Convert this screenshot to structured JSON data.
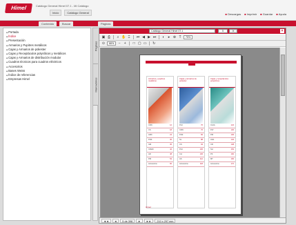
{
  "app": {
    "logo": "Himel",
    "title": "Catálogo General Himel 07.1  -  Mi Catálogo"
  },
  "topnav": [
    "Inicio",
    "Catálogo General"
  ],
  "toplinks": [
    "Descargas",
    "Imprimir",
    "Guardar",
    "Ayuda"
  ],
  "tabs": [
    "Contenido",
    "Buscar",
    "Páginas"
  ],
  "sidebar": {
    "items": [
      "Portada",
      "Índice",
      "Presentación",
      "Armarios y Pupitres metálicos",
      "Cajas y Armarios de poliester",
      "Cajas y Receptáculos polysíticos y metálicos",
      "Cajas y Armarios de distribución modular",
      "Cuadros técnicos para cuadros eléctricos",
      "Accesorios",
      "Bases Weiss",
      "Índice de referencias",
      "Empresas Himel"
    ],
    "active_index": 1
  },
  "vtabs": [
    "Páginas",
    "Marcadores"
  ],
  "viewer": {
    "doc_title": "Catálogo General Himel 07.1",
    "page_number": "5",
    "go_label": "Ir",
    "close": "×",
    "zoom": "66%",
    "zoom2": "75%",
    "toolbar_icons": [
      "save-icon",
      "print-icon",
      "find-icon",
      "hand-icon",
      "select-icon",
      "first-page-icon",
      "prev-page-icon",
      "next-page-icon",
      "last-page-icon",
      "back-icon",
      "forward-icon",
      "zoom-in-icon",
      "text-icon"
    ],
    "status": [
      "◄◄",
      "◄",
      "5 de 398",
      "►",
      "►►",
      "210 x 297 mm"
    ]
  },
  "page": {
    "columns": [
      {
        "heading": "Armarios y pupitres metálicos",
        "image_color": "#d9542f",
        "rows": [
          [
            "CRN",
            "12"
          ],
          [
            "CS",
            "18"
          ],
          [
            "AMC",
            "24"
          ],
          [
            "PLM",
            "30"
          ],
          [
            "GM",
            "36"
          ],
          [
            "CRHN",
            "42"
          ],
          [
            "AR",
            "48"
          ],
          [
            "PM",
            "54"
          ],
          [
            "Accesorios",
            "60"
          ]
        ]
      },
      {
        "heading": "Cajas y armarios de poliester",
        "image_color": "#3f77b8",
        "rows": [
          [
            "PLC",
            "70"
          ],
          [
            "CRN",
            "76"
          ],
          [
            "PLM",
            "82"
          ],
          [
            "SL",
            "88"
          ],
          [
            "CS",
            "94"
          ],
          [
            "PLC",
            "100"
          ],
          [
            "CH",
            "106"
          ],
          [
            "AS",
            "112"
          ],
          [
            "Accesorios",
            "118"
          ]
        ]
      },
      {
        "heading": "Cajas y receptáculos polysíticos",
        "image_color": "#3fa8a2",
        "rows": [
          [
            "CAJA",
            "124"
          ],
          [
            "PLT",
            "130"
          ],
          [
            "PM",
            "136"
          ],
          [
            "ASA",
            "142"
          ],
          [
            "CR",
            "148"
          ],
          [
            "SH",
            "154"
          ],
          [
            "PK",
            "160"
          ],
          [
            "MT",
            "166"
          ],
          [
            "Accesorios",
            "172"
          ]
        ]
      }
    ],
    "footer": "Himel"
  }
}
